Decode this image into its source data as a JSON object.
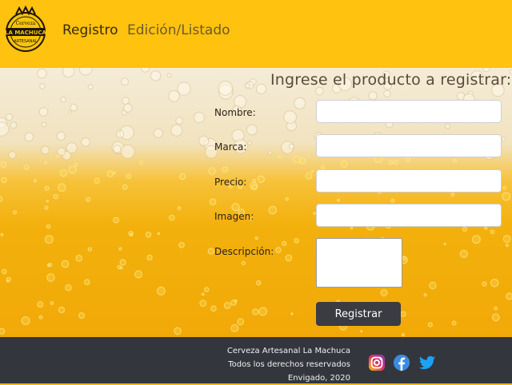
{
  "brand": {
    "logo_text_top": "Cerveza",
    "logo_text_main": "LA MACHUCA",
    "logo_text_bottom": "ARTESANAL"
  },
  "nav": {
    "items": [
      {
        "label": "Registro",
        "active": true
      },
      {
        "label": "Edición/Listado",
        "active": false
      }
    ]
  },
  "form": {
    "title": "Ingrese el producto a registrar:",
    "fields": [
      {
        "label": "Nombre:",
        "value": "",
        "placeholder": ""
      },
      {
        "label": "Marca:",
        "value": "",
        "placeholder": ""
      },
      {
        "label": "Precio:",
        "value": "",
        "placeholder": ""
      },
      {
        "label": "Imagen:",
        "value": "",
        "placeholder": ""
      }
    ],
    "description_label": "Descripción:",
    "description_value": "",
    "submit_label": "Registrar"
  },
  "footer": {
    "line1": "Cerveza Artesanal La Machuca",
    "line2": "Todos los derechos reservados",
    "line3": "Envigado, 2020",
    "social": [
      {
        "icon": "instagram-icon",
        "color": "#d6249f"
      },
      {
        "icon": "facebook-icon",
        "color": "#3b8be0"
      },
      {
        "icon": "twitter-icon",
        "color": "#1da1f2"
      }
    ]
  },
  "colors": {
    "header_bg": "#ffc20e",
    "footer_bg": "#33363d",
    "button_bg": "#3a3c42"
  }
}
